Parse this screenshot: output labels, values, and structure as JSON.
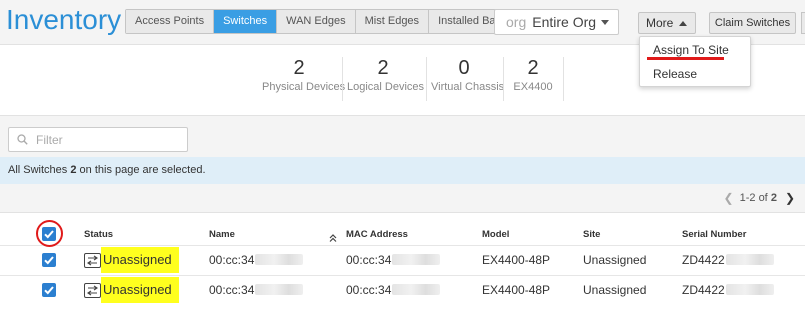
{
  "header": {
    "title": "Inventory",
    "tabs": [
      {
        "label": "Access Points",
        "active": false
      },
      {
        "label": "Switches",
        "active": true
      },
      {
        "label": "WAN Edges",
        "active": false
      },
      {
        "label": "Mist Edges",
        "active": false
      },
      {
        "label": "Installed Base",
        "active": false
      }
    ],
    "org_label": "org",
    "org_value": "Entire Org",
    "more_label": "More",
    "claim_label": "Claim Switches"
  },
  "menu": {
    "items": [
      "Assign To Site",
      "Release"
    ]
  },
  "stats": [
    {
      "value": "2",
      "label": "Physical Devices"
    },
    {
      "value": "2",
      "label": "Logical Devices"
    },
    {
      "value": "0",
      "label": "Virtual Chassis"
    },
    {
      "value": "2",
      "label": "EX4400"
    }
  ],
  "filter": {
    "placeholder": "Filter"
  },
  "banner": {
    "prefix": "All Switches",
    "count": "2",
    "suffix": "on this page are selected."
  },
  "pager": {
    "range": "1-2 of",
    "total": "2"
  },
  "table": {
    "columns": [
      "Status",
      "Name",
      "MAC Address",
      "Model",
      "Site",
      "Serial Number"
    ],
    "rows": [
      {
        "status": "Unassigned",
        "name": "00:cc:34",
        "mac": "00:cc:34",
        "model": "EX4400-48P",
        "site": "Unassigned",
        "serial": "ZD4422"
      },
      {
        "status": "Unassigned",
        "name": "00:cc:34",
        "mac": "00:cc:34",
        "model": "EX4400-48P",
        "site": "Unassigned",
        "serial": "ZD4422"
      }
    ]
  },
  "colors": {
    "accent": "#3a9ee4",
    "highlight": "#ffff1e",
    "annotation": "#e01a1a"
  }
}
